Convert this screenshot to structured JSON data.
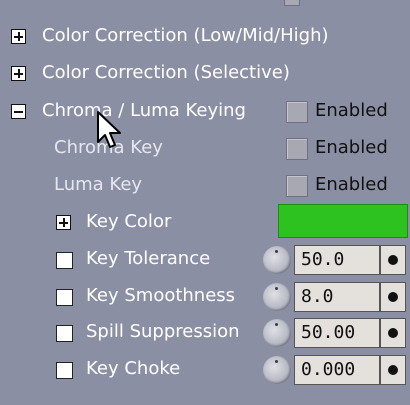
{
  "rows": [
    {
      "label": "Color Correction (Low/Mid/High)"
    },
    {
      "label": "Color Correction (Selective)"
    },
    {
      "label": "Chroma / Luma Keying",
      "enabled_label": "Enabled"
    },
    {
      "label": "Chroma Key",
      "enabled_label": "Enabled"
    },
    {
      "label": "Luma Key",
      "enabled_label": "Enabled"
    },
    {
      "label": "Key Color",
      "swatch_color": "#2dc220"
    },
    {
      "label": "Key Tolerance",
      "value": "50.0"
    },
    {
      "label": "Key Smoothness",
      "value": "8.0"
    },
    {
      "label": "Spill Suppression",
      "value": "50.00"
    },
    {
      "label": "Key Choke",
      "value": "0.000"
    }
  ],
  "colors": {
    "panel_bg": "#8b8fa3",
    "swatch": "#2dc220",
    "field_bg": "#e4e0dc"
  },
  "icons": {
    "expand": "plus-box-icon",
    "collapse": "minus-box-icon",
    "cursor": "arrow-pointer-icon",
    "knob": "rotary-knob-icon"
  }
}
